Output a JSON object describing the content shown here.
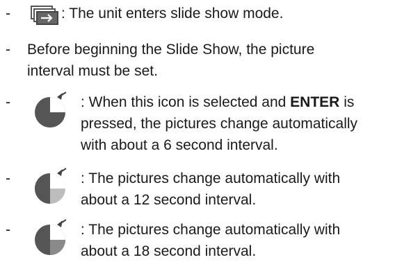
{
  "items": [
    {
      "dash": "-",
      "icon": "slideshow-icon",
      "lines": [
        ": The unit enters slide show mode."
      ]
    },
    {
      "dash": "-",
      "lines": [
        "Before beginning the Slide Show, the picture",
        "interval must be set."
      ]
    },
    {
      "dash": "-",
      "icon": "timer-6s-icon",
      "line1_pre": ": When this icon is selected and ",
      "line1_bold": "ENTER",
      "line1_post": " is",
      "lines": [
        "pressed, the pictures change automatically",
        "with about a 6 second interval."
      ]
    },
    {
      "dash": "-",
      "icon": "timer-12s-icon",
      "lines": [
        ": The pictures change automatically with",
        "about a 12 second interval."
      ]
    },
    {
      "dash": "-",
      "icon": "timer-18s-icon",
      "lines": [
        ": The pictures change automatically with",
        "about a 18 second interval."
      ]
    }
  ],
  "colors": {
    "text": "#1a1a1a",
    "icon_dark": "#555555",
    "icon_light": "#9a9a9a",
    "accent": "#e65a1e"
  }
}
